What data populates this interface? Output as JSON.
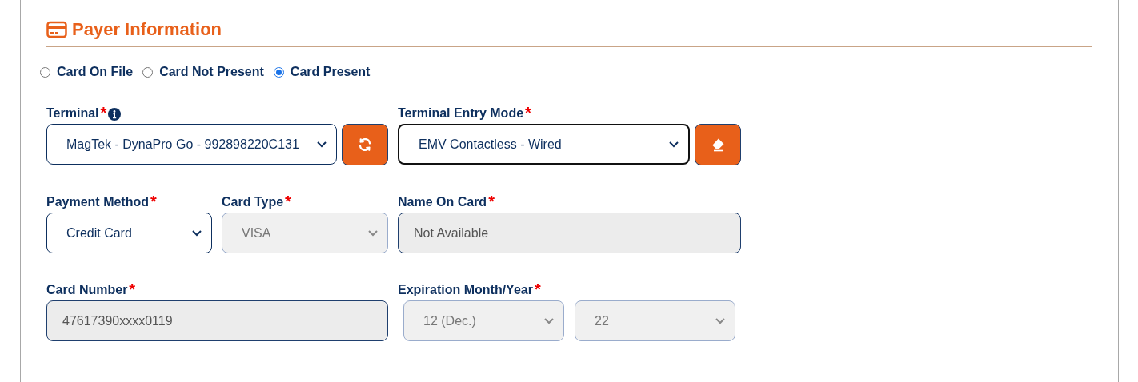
{
  "section": {
    "title": "Payer Information"
  },
  "card_modes": [
    {
      "label": "Card On File",
      "selected": false
    },
    {
      "label": "Card Not Present",
      "selected": false
    },
    {
      "label": "Card Present",
      "selected": true
    }
  ],
  "rows": [
    [
      {
        "kind": "select",
        "label": "Terminal",
        "required_mark": "*",
        "info": true,
        "value": "MagTek - DynaPro Go - 992898220C131",
        "disabled": false,
        "focused": false,
        "action": {
          "kind": "refresh"
        }
      },
      {
        "kind": "select",
        "label": "Terminal Entry Mode",
        "required_mark": "*",
        "value": "EMV Contactless - Wired",
        "disabled": false,
        "focused": true,
        "action": {
          "kind": "clear"
        }
      }
    ],
    [
      {
        "kind": "select",
        "label": "Payment Method",
        "required_mark": "*",
        "value": "Credit Card",
        "disabled": false,
        "focused": false
      },
      {
        "kind": "select",
        "label": "Card Type",
        "required_mark": "*",
        "value": "VISA",
        "disabled": true,
        "focused": false
      },
      {
        "kind": "input",
        "label": "Name On Card",
        "required_mark": "*",
        "value": "Not Available",
        "disabled": true,
        "focused": false
      }
    ],
    [
      {
        "kind": "input",
        "label": "Card Number",
        "required_mark": "*",
        "value": "47617390xxxx0119",
        "disabled": true,
        "focused": false
      },
      {
        "kind": "select_pair",
        "label": "Expiration Month/Year",
        "required_mark": "*",
        "disabled": true,
        "focused": false,
        "values": [
          "12 (Dec.)",
          "22"
        ]
      }
    ]
  ]
}
